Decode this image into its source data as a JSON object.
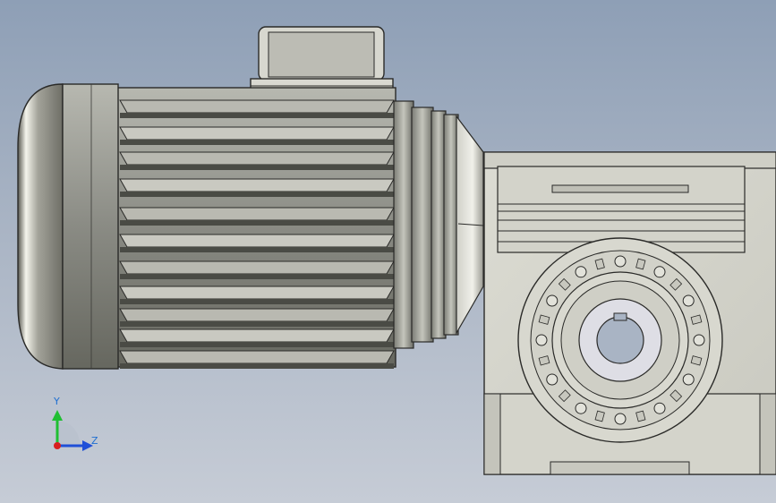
{
  "viewport": {
    "background_top": "#8e9fb6",
    "background_bottom": "#c6ccd6"
  },
  "model": {
    "icon": "motor-gearbox-assembly",
    "body_color": "#8b8c86",
    "face_color": "#d9d9d1",
    "gearbox_color": "#d6d6cc"
  },
  "triad": {
    "icon": "coordinate-triad",
    "y_label": "Y",
    "z_label": "Z",
    "y_color": "#1fbf32",
    "z_color": "#1f4fd8",
    "x_color": "#d81f1f"
  }
}
